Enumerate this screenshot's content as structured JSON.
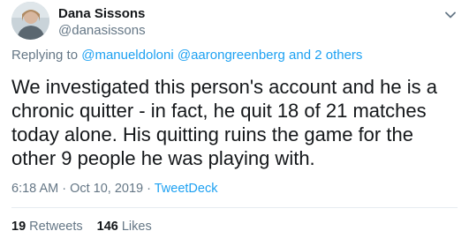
{
  "author": {
    "display_name": "Dana Sissons",
    "handle": "@danasissons"
  },
  "reply": {
    "prefix": "Replying to ",
    "mention1": "@manueldoloni",
    "space": " ",
    "mention2": "@aarongreenberg",
    "joiner": " and ",
    "others": "2 others"
  },
  "tweet": {
    "text": "We investigated this person's account and he is a chronic quitter - in fact, he quit 18 of 21 matches today alone. His quitting ruins the game for the other 9 people he was playing with."
  },
  "meta": {
    "time": "6:18 AM",
    "sep1": " · ",
    "date": "Oct 10, 2019",
    "sep2": " · ",
    "source": "TweetDeck"
  },
  "stats": {
    "retweets_count": "19",
    "retweets_label": " Retweets",
    "likes_count": "146",
    "likes_label": " Likes"
  },
  "colors": {
    "link": "#1da1f2",
    "secondary_text": "#657786",
    "primary_text": "#14171a"
  },
  "icons": {
    "avatar": "user-avatar",
    "menu": "chevron-down-icon"
  }
}
